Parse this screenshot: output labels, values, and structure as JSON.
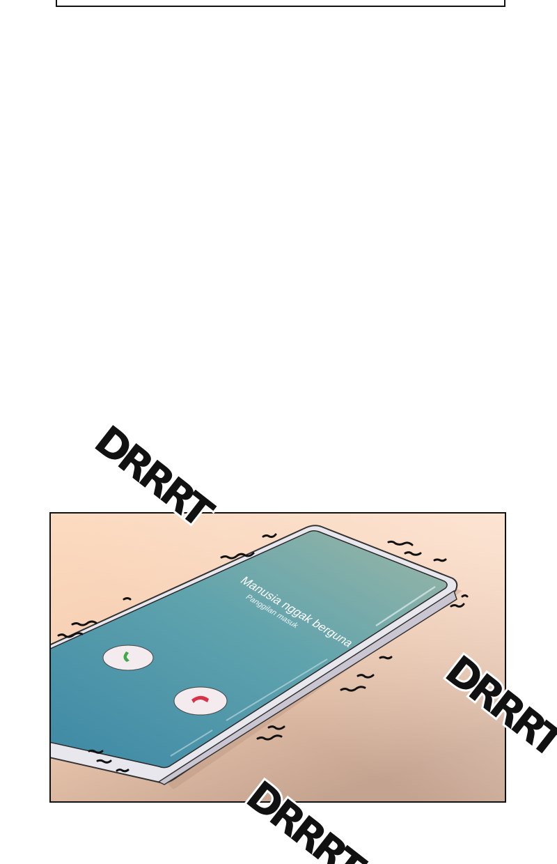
{
  "phone": {
    "caller_name": "Manusia nggak berguna",
    "call_status": "Panggilan masuk",
    "accept_icon": "phone-accept-icon",
    "decline_icon": "phone-decline-icon",
    "accept_color": "#3fa84a",
    "decline_color": "#d8324a"
  },
  "sound_effects": {
    "sfx_top": "DRRRT",
    "sfx_right": "DRRRT",
    "sfx_bottom": "DRRRT"
  },
  "colors": {
    "panel_gradient_top": "#fcdcc2",
    "panel_gradient_bottom": "#c2a391",
    "screen_top": "#9fb7a8",
    "screen_bottom": "#3e8aa6"
  }
}
